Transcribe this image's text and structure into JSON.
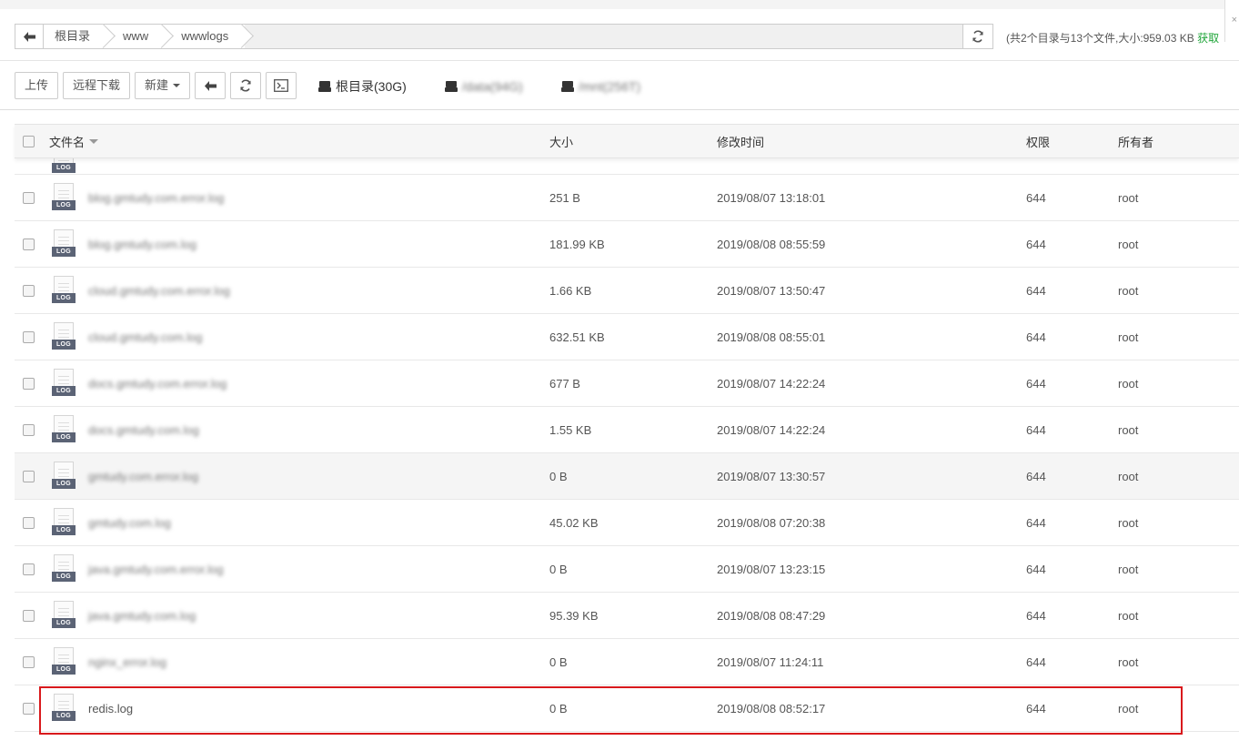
{
  "path": {
    "back_icon": "arrow-left-icon",
    "crumbs": [
      "根目录",
      "www",
      "wwwlogs"
    ],
    "refresh_icon": "refresh-icon",
    "summary": "(共2个目录与13个文件,大小:959.03 KB ",
    "summary_link": "获取"
  },
  "corner_glyph": "×",
  "toolbar": {
    "upload": "上传",
    "remote_download": "远程下载",
    "new": "新建",
    "back_icon": "arrow-left-icon",
    "refresh_icon": "refresh-icon",
    "terminal_icon": "terminal-icon"
  },
  "disks": [
    {
      "label": "根目录(30G)",
      "blurred": false
    },
    {
      "label": "/data(94G)",
      "blurred": true
    },
    {
      "label": "/mnt(256T)",
      "blurred": true
    }
  ],
  "table": {
    "headers": {
      "name": "文件名",
      "size": "大小",
      "mtime": "修改时间",
      "perm": "权限",
      "owner": "所有者"
    },
    "icon_tag": "LOG",
    "rows": [
      {
        "name": "blog.gmtudy.com.error.log",
        "size": "251 B",
        "mtime": "2019/08/07 13:18:01",
        "perm": "644",
        "owner": "root",
        "blurred": true
      },
      {
        "name": "blog.gmtudy.com.log",
        "size": "181.99 KB",
        "mtime": "2019/08/08 08:55:59",
        "perm": "644",
        "owner": "root",
        "blurred": true
      },
      {
        "name": "cloud.gmtudy.com.error.log",
        "size": "1.66 KB",
        "mtime": "2019/08/07 13:50:47",
        "perm": "644",
        "owner": "root",
        "blurred": true
      },
      {
        "name": "cloud.gmtudy.com.log",
        "size": "632.51 KB",
        "mtime": "2019/08/08 08:55:01",
        "perm": "644",
        "owner": "root",
        "blurred": true
      },
      {
        "name": "docs.gmtudy.com.error.log",
        "size": "677 B",
        "mtime": "2019/08/07 14:22:24",
        "perm": "644",
        "owner": "root",
        "blurred": true
      },
      {
        "name": "docs.gmtudy.com.log",
        "size": "1.55 KB",
        "mtime": "2019/08/07 14:22:24",
        "perm": "644",
        "owner": "root",
        "blurred": true
      },
      {
        "name": "gmtudy.com.error.log",
        "size": "0 B",
        "mtime": "2019/08/07 13:30:57",
        "perm": "644",
        "owner": "root",
        "blurred": true
      },
      {
        "name": "gmtudy.com.log",
        "size": "45.02 KB",
        "mtime": "2019/08/08 07:20:38",
        "perm": "644",
        "owner": "root",
        "blurred": true
      },
      {
        "name": "java.gmtudy.com.error.log",
        "size": "0 B",
        "mtime": "2019/08/07 13:23:15",
        "perm": "644",
        "owner": "root",
        "blurred": true
      },
      {
        "name": "java.gmtudy.com.log",
        "size": "95.39 KB",
        "mtime": "2019/08/08 08:47:29",
        "perm": "644",
        "owner": "root",
        "blurred": true
      },
      {
        "name": "nginx_error.log",
        "size": "0 B",
        "mtime": "2019/08/07 11:24:11",
        "perm": "644",
        "owner": "root",
        "blurred": true
      },
      {
        "name": "redis.log",
        "size": "0 B",
        "mtime": "2019/08/08 08:52:17",
        "perm": "644",
        "owner": "root",
        "blurred": false
      }
    ]
  },
  "colors": {
    "accent_green": "#20a53a",
    "highlight_red": "#d9191c",
    "log_tag": "#5b6375"
  }
}
